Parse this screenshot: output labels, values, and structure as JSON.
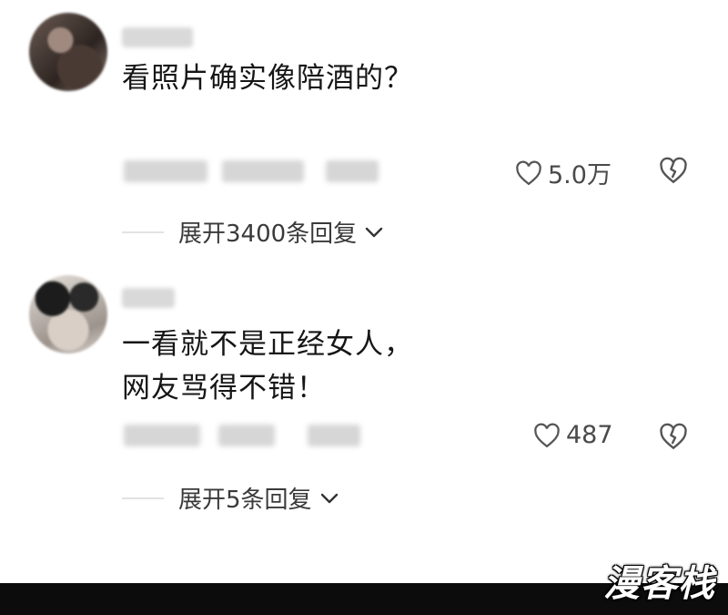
{
  "comments": [
    {
      "text": "看照片确实像陪酒的？",
      "likes": "5.0万",
      "expand_label": "展开3400条回复"
    },
    {
      "text": "一看就不是正经女人，\n网友骂得不错！",
      "likes": "487",
      "expand_label": "展开5条回复"
    }
  ],
  "icons": {
    "like": "heart-outline-icon",
    "dislike": "broken-heart-icon",
    "expand": "chevron-down-icon"
  },
  "watermark": "漫客栈",
  "colors": {
    "text": "#161616",
    "secondary": "#4a4a4a",
    "divider": "#e2e2e2",
    "footer": "#0c0c0c"
  }
}
